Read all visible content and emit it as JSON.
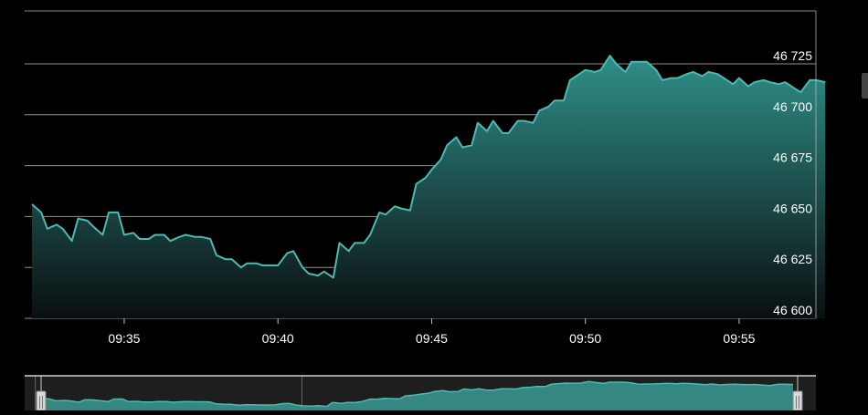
{
  "colors": {
    "background": "#000000",
    "line": "#4fb8b0",
    "fill_top": "#2f8f89",
    "fill_bottom": "#0a0f10",
    "grid": "#bfbfbf",
    "text": "#ffffff",
    "navigator_bg": "#1e1e1e",
    "navigator_fill": "#3a9a94"
  },
  "chart_data": {
    "type": "area",
    "title": "",
    "xlabel": "",
    "ylabel": "",
    "x_ticks": [
      "09:35",
      "09:40",
      "09:45",
      "09:50",
      "09:55"
    ],
    "x_tick_minutes": [
      35,
      40,
      45,
      50,
      55
    ],
    "y_ticks": [
      "46 600",
      "46 625",
      "46 650",
      "46 675",
      "46 700",
      "46 725"
    ],
    "y_tick_values": [
      46600,
      46625,
      46650,
      46675,
      46700,
      46725
    ],
    "ylim": [
      46600,
      46750
    ],
    "xlim_minutes": [
      32,
      58
    ],
    "grid": true,
    "y_axis_position": "right",
    "series": [
      {
        "x_minutes": [
          32.0,
          32.3,
          32.5,
          32.8,
          33.0,
          33.3,
          33.5,
          33.8,
          34.0,
          34.3,
          34.5,
          34.8,
          35.0,
          35.3,
          35.5,
          35.8,
          36.0,
          36.3,
          36.5,
          36.8,
          37.0,
          37.3,
          37.5,
          37.8,
          38.0,
          38.3,
          38.5,
          38.8,
          39.0,
          39.3,
          39.5,
          39.8,
          40.0,
          40.3,
          40.5,
          40.8,
          41.0,
          41.3,
          41.5,
          41.8,
          42.0,
          42.3,
          42.5,
          42.8,
          43.0,
          43.3,
          43.5,
          43.8,
          44.0,
          44.3,
          44.5,
          44.8,
          45.0,
          45.3,
          45.5,
          45.8,
          46.0,
          46.3,
          46.5,
          46.8,
          47.0,
          47.3,
          47.5,
          47.8,
          48.0,
          48.3,
          48.5,
          48.8,
          49.0,
          49.3,
          49.5,
          49.8,
          50.0,
          50.3,
          50.5,
          50.8,
          51.0,
          51.3,
          51.5,
          51.8,
          52.0,
          52.3,
          52.5,
          52.8,
          53.0,
          53.3,
          53.5,
          53.8,
          54.0,
          54.3,
          54.5,
          54.8,
          55.0,
          55.3,
          55.5,
          55.8,
          56.0,
          56.3,
          56.5,
          56.8,
          57.0,
          57.3,
          57.5,
          57.8
        ],
        "y": [
          46656,
          46652,
          46644,
          46646,
          46644,
          46638,
          46649,
          46648,
          46645,
          46641,
          46652,
          46652,
          46641,
          46642,
          46639,
          46639,
          46641,
          46641,
          46638,
          46640,
          46641,
          46640,
          46640,
          46639,
          46631,
          46629,
          46629,
          46625,
          46627,
          46627,
          46626,
          46626,
          46626,
          46632,
          46633,
          46625,
          46622,
          46621,
          46623,
          46620,
          46637,
          46633,
          46637,
          46637,
          46641,
          46652,
          46651,
          46655,
          46654,
          46653,
          46666,
          46669,
          46673,
          46678,
          46685,
          46689,
          46684,
          46685,
          46696,
          46692,
          46697,
          46691,
          46691,
          46697,
          46697,
          46696,
          46702,
          46704,
          46707,
          46707,
          46717,
          46720,
          46722,
          46721,
          46722,
          46729,
          46725,
          46721,
          46726,
          46726,
          46726,
          46722,
          46717,
          46718,
          46718,
          46720,
          46721,
          46719,
          46721,
          46720,
          46718,
          46715,
          46718,
          46714,
          46716,
          46717,
          46716,
          46715,
          46716,
          46713,
          46711,
          46717,
          46717,
          46716
        ]
      }
    ],
    "navigator": {
      "x_tick_minutes": [
        30,
        45
      ],
      "selected_range_minutes": [
        32,
        58
      ]
    }
  }
}
